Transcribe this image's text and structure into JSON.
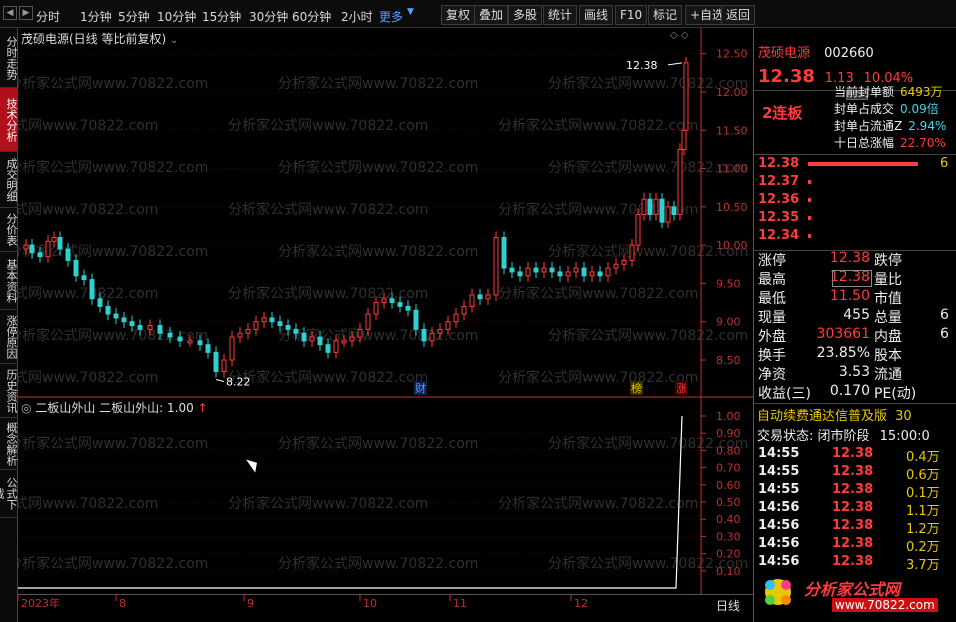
{
  "toolbar": {
    "periods": [
      "分时",
      "1分钟",
      "5分钟",
      "10分钟",
      "15分钟",
      "30分钟",
      "60分钟",
      "2小时"
    ],
    "more": "更多",
    "buttons": [
      "复权",
      "叠加",
      "多股",
      "统计",
      "画线",
      "F10",
      "标记",
      "+自选",
      "返回"
    ]
  },
  "left_tabs": [
    "分时走势",
    "技术分析",
    "成交明细",
    "分价表",
    "基本资料",
    "涨停原因",
    "历史资讯",
    "概念解析",
    "公式下载"
  ],
  "active_tab": "技术分析",
  "main_chart": {
    "title": "茂硕电源(日线 等比前复权)",
    "y_ticks": [
      "12.50",
      "12.00",
      "11.50",
      "11.00",
      "10.50",
      "10.00",
      "9.50",
      "9.00",
      "8.50"
    ],
    "high_label": "12.38",
    "low_label": "8.22",
    "markers": {
      "cai": "财",
      "bang": "榜",
      "zhang": "涨"
    },
    "watermark": "分析家公式网www.70822.com"
  },
  "indicator": {
    "title": "二板山外山",
    "value_label": "二板山外山: 1.00",
    "y_ticks": [
      "1.00",
      "0.90",
      "0.80",
      "0.70",
      "0.60",
      "0.50",
      "0.40",
      "0.30",
      "0.20",
      "0.10"
    ]
  },
  "x_axis": {
    "labels": [
      "2023年",
      "8",
      "9",
      "10",
      "11",
      "12"
    ],
    "period": "日线"
  },
  "chart_data": {
    "type": "candlestick",
    "ylim": [
      8.2,
      12.6
    ],
    "price_range": {
      "low": 8.22,
      "high": 12.38
    }
  },
  "quote": {
    "name": "茂硕电源",
    "code": "002660",
    "price": "12.38",
    "change": "1.13",
    "pct": "10.04%",
    "streak": "2连板",
    "seal_items": [
      {
        "label": "当前封单额",
        "value": "6493万"
      },
      {
        "label": "封单占成交",
        "value": "0.09倍"
      },
      {
        "label": "封单占流通Z",
        "value": "2.94%"
      },
      {
        "label": "十日总涨幅",
        "value": "22.70%"
      }
    ],
    "bids": [
      {
        "price": "12.38",
        "vol": "6"
      },
      {
        "price": "12.37",
        "vol": ""
      },
      {
        "price": "12.36",
        "vol": ""
      },
      {
        "price": "12.35",
        "vol": ""
      },
      {
        "price": "12.34",
        "vol": ""
      }
    ],
    "stats": [
      {
        "l1": "涨停",
        "v1": "12.38",
        "l2": "跌停",
        "v2": ""
      },
      {
        "l1": "最高",
        "v1": "12.38",
        "l2": "量比",
        "v2": ""
      },
      {
        "l1": "最低",
        "v1": "11.50",
        "l2": "市值",
        "v2": ""
      },
      {
        "l1": "现量",
        "v1": "455",
        "l2": "总量",
        "v2": "6"
      },
      {
        "l1": "外盘",
        "v1": "303661",
        "l2": "内盘",
        "v2": "6"
      },
      {
        "l1": "换手",
        "v1": "23.85%",
        "l2": "股本",
        "v2": ""
      },
      {
        "l1": "净资",
        "v1": "3.53",
        "l2": "流通",
        "v2": ""
      },
      {
        "l1": "收益(三)",
        "v1": "0.170",
        "l2": "PE(动)",
        "v2": ""
      }
    ],
    "banner": "自动续费通达信普及版",
    "banner_extra": "30",
    "trade_status": "交易状态: 闭市阶段",
    "trade_time": "15:00:0",
    "ticks": [
      {
        "t": "14:55",
        "p": "12.38",
        "v": "0.4万"
      },
      {
        "t": "14:55",
        "p": "12.38",
        "v": "0.6万"
      },
      {
        "t": "14:55",
        "p": "12.38",
        "v": "0.1万"
      },
      {
        "t": "14:56",
        "p": "12.38",
        "v": "1.1万"
      },
      {
        "t": "14:56",
        "p": "12.38",
        "v": "1.2万"
      },
      {
        "t": "14:56",
        "p": "12.38",
        "v": "0.2万"
      },
      {
        "t": "14:56",
        "p": "12.38",
        "v": "3.7万"
      }
    ],
    "logo_text": "分析家公式网",
    "logo_url": "www.70822.com"
  }
}
